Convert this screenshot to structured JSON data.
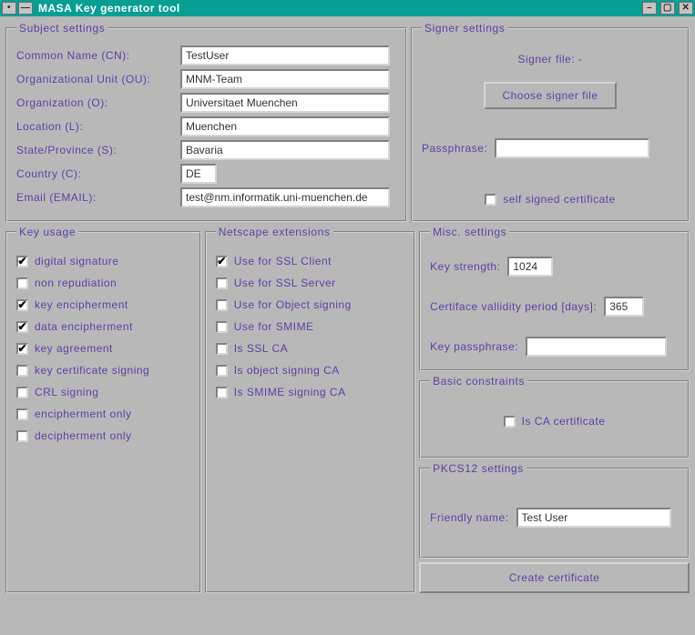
{
  "title": "MASA Key generator tool",
  "subject": {
    "legend": "Subject settings",
    "fields": {
      "cn": {
        "label": "Common Name (CN):",
        "value": "TestUser"
      },
      "ou": {
        "label": "Organizational Unit (OU):",
        "value": "MNM-Team"
      },
      "o": {
        "label": "Organization (O):",
        "value": "Universitaet Muenchen"
      },
      "l": {
        "label": "Location (L):",
        "value": "Muenchen"
      },
      "s": {
        "label": "State/Province (S):",
        "value": "Bavaria"
      },
      "c": {
        "label": "Country (C):",
        "value": "DE"
      },
      "mail": {
        "label": "Email (EMAIL):",
        "value": "test@nm.informatik.uni-muenchen.de"
      }
    }
  },
  "signer": {
    "legend": "Signer settings",
    "file_label": "Signer file: -",
    "choose_btn": "Choose signer file",
    "passphrase_label": "Passphrase:",
    "passphrase_value": "",
    "selfsigned_label": "self signed certificate",
    "selfsigned_checked": false
  },
  "keyusage": {
    "legend": "Key usage",
    "items": [
      {
        "label": "digital signature",
        "checked": true
      },
      {
        "label": "non repudiation",
        "checked": false
      },
      {
        "label": "key encipherment",
        "checked": true
      },
      {
        "label": "data encipherment",
        "checked": true
      },
      {
        "label": "key agreement",
        "checked": true
      },
      {
        "label": "key certificate signing",
        "checked": false
      },
      {
        "label": "CRL signing",
        "checked": false
      },
      {
        "label": "encipherment only",
        "checked": false
      },
      {
        "label": "decipherment only",
        "checked": false
      }
    ]
  },
  "netscape": {
    "legend": "Netscape extensions",
    "items": [
      {
        "label": "Use for SSL Client",
        "checked": true
      },
      {
        "label": "Use for SSL Server",
        "checked": false
      },
      {
        "label": "Use for Object signing",
        "checked": false
      },
      {
        "label": "Use for SMIME",
        "checked": false
      },
      {
        "label": "Is SSL CA",
        "checked": false
      },
      {
        "label": "Is object signing CA",
        "checked": false
      },
      {
        "label": "Is SMIME signing CA",
        "checked": false
      }
    ]
  },
  "misc": {
    "legend": "Misc. settings",
    "strength_label": "Key strength:",
    "strength_value": "1024",
    "validity_label": "Certiface vallidity period [days]:",
    "validity_value": "365",
    "passphrase_label": "Key passphrase:",
    "passphrase_value": ""
  },
  "basic": {
    "legend": "Basic constraints",
    "isca_label": "Is CA certificate",
    "isca_checked": false
  },
  "pkcs12": {
    "legend": "PKCS12 settings",
    "friendly_label": "Friendly name:",
    "friendly_value": "Test User"
  },
  "create_btn": "Create certificate"
}
